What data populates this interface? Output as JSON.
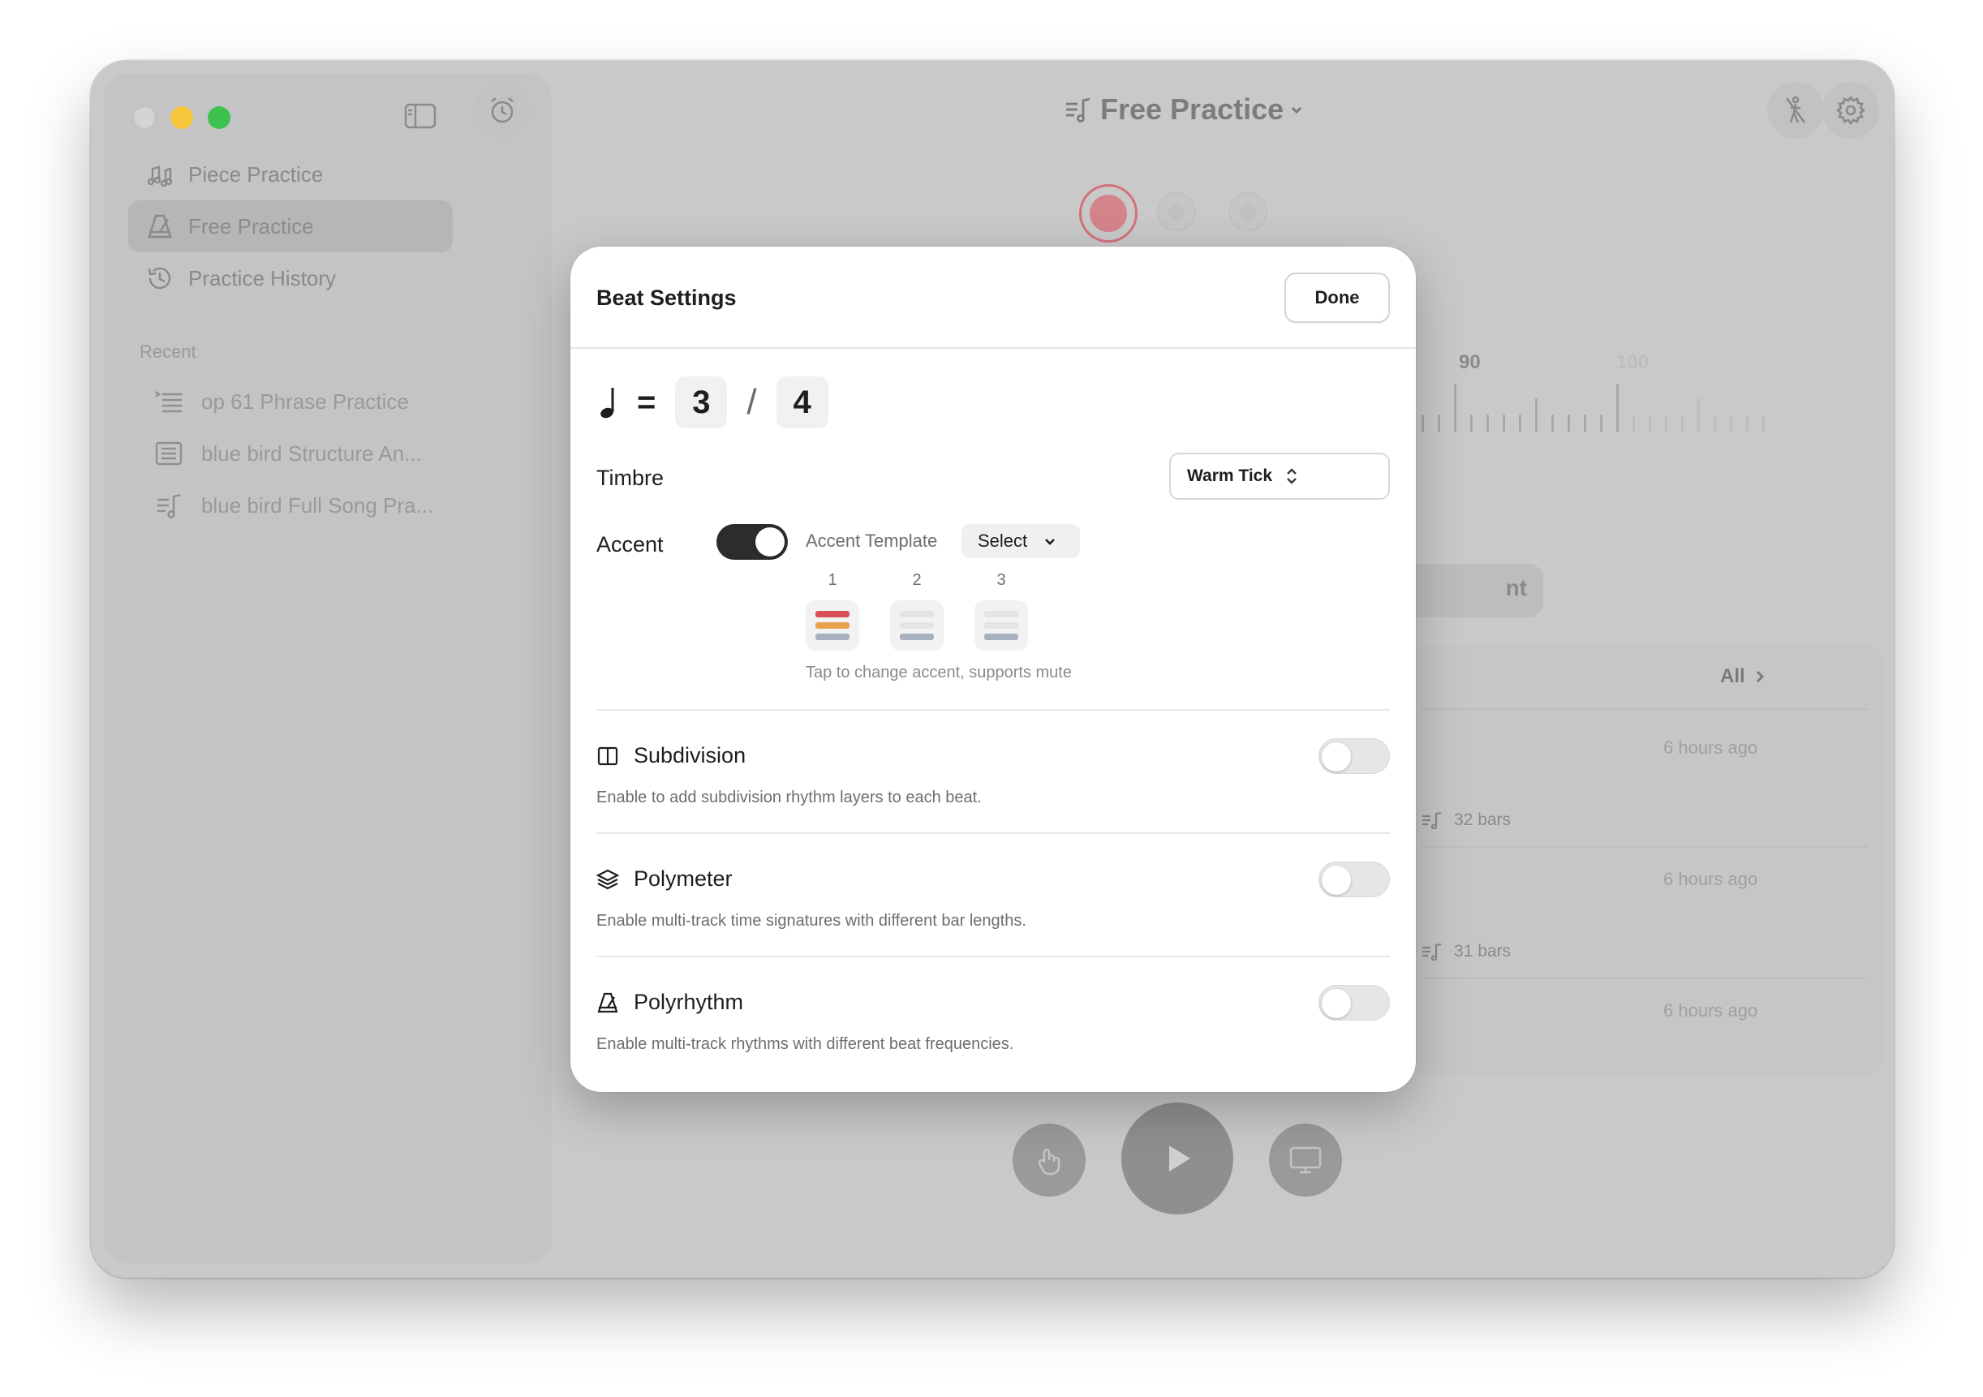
{
  "sidebar": {
    "nav": [
      {
        "label": "Piece Practice",
        "icon": "music-notes-icon"
      },
      {
        "label": "Free Practice",
        "icon": "metronome-icon",
        "active": true
      },
      {
        "label": "Practice History",
        "icon": "history-clock-icon"
      }
    ],
    "recent_label": "Recent",
    "recent": [
      {
        "label": "op 61 Phrase Practice",
        "icon": "list-icon"
      },
      {
        "label": "blue bird Structure An...",
        "icon": "document-list-icon"
      },
      {
        "label": "blue bird Full Song Pra...",
        "icon": "music-list-icon"
      }
    ]
  },
  "header": {
    "title": "Free Practice"
  },
  "background": {
    "ruler_labels": [
      "90",
      "100"
    ],
    "chip_text": "nt",
    "all_label": "All",
    "history": [
      {
        "time": "6 hours ago",
        "bars": "32 bars"
      },
      {
        "time": "6 hours ago",
        "bars": "31 bars"
      },
      {
        "time": "6 hours ago"
      }
    ]
  },
  "modal": {
    "title": "Beat Settings",
    "done_label": "Done",
    "time_signature": {
      "equals": "=",
      "numerator": "3",
      "slash": "/",
      "denominator": "4"
    },
    "timbre_label": "Timbre",
    "timbre_value": "Warm Tick",
    "accent_label": "Accent",
    "accent_enabled": true,
    "accent_template_label": "Accent Template",
    "accent_template_value": "Select",
    "beats": [
      "1",
      "2",
      "3"
    ],
    "accent_hint": "Tap to change accent, supports mute",
    "features": [
      {
        "title": "Subdivision",
        "desc": "Enable to add subdivision rhythm layers to each beat.",
        "enabled": false
      },
      {
        "title": "Polymeter",
        "desc": "Enable multi-track time signatures with different bar lengths.",
        "enabled": false
      },
      {
        "title": "Polyrhythm",
        "desc": "Enable multi-track rhythms with different beat frequencies.",
        "enabled": false
      }
    ]
  },
  "colors": {
    "accent_strong": "#d9505a",
    "accent_medium": "#e9a24e",
    "accent_soft": "#a9b0bd",
    "toggle_on": "#2c2c2c",
    "record_red": "#d9707a"
  }
}
